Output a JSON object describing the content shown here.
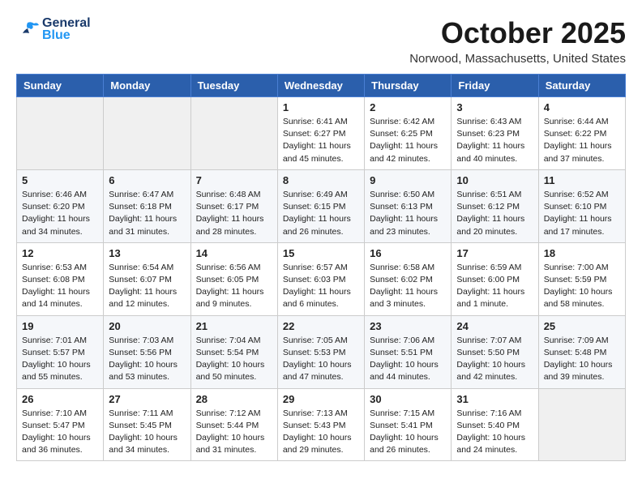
{
  "header": {
    "logo_line1": "General",
    "logo_line2": "Blue",
    "month": "October 2025",
    "location": "Norwood, Massachusetts, United States"
  },
  "weekdays": [
    "Sunday",
    "Monday",
    "Tuesday",
    "Wednesday",
    "Thursday",
    "Friday",
    "Saturday"
  ],
  "weeks": [
    [
      {
        "day": "",
        "info": ""
      },
      {
        "day": "",
        "info": ""
      },
      {
        "day": "",
        "info": ""
      },
      {
        "day": "1",
        "info": "Sunrise: 6:41 AM\nSunset: 6:27 PM\nDaylight: 11 hours\nand 45 minutes."
      },
      {
        "day": "2",
        "info": "Sunrise: 6:42 AM\nSunset: 6:25 PM\nDaylight: 11 hours\nand 42 minutes."
      },
      {
        "day": "3",
        "info": "Sunrise: 6:43 AM\nSunset: 6:23 PM\nDaylight: 11 hours\nand 40 minutes."
      },
      {
        "day": "4",
        "info": "Sunrise: 6:44 AM\nSunset: 6:22 PM\nDaylight: 11 hours\nand 37 minutes."
      }
    ],
    [
      {
        "day": "5",
        "info": "Sunrise: 6:46 AM\nSunset: 6:20 PM\nDaylight: 11 hours\nand 34 minutes."
      },
      {
        "day": "6",
        "info": "Sunrise: 6:47 AM\nSunset: 6:18 PM\nDaylight: 11 hours\nand 31 minutes."
      },
      {
        "day": "7",
        "info": "Sunrise: 6:48 AM\nSunset: 6:17 PM\nDaylight: 11 hours\nand 28 minutes."
      },
      {
        "day": "8",
        "info": "Sunrise: 6:49 AM\nSunset: 6:15 PM\nDaylight: 11 hours\nand 26 minutes."
      },
      {
        "day": "9",
        "info": "Sunrise: 6:50 AM\nSunset: 6:13 PM\nDaylight: 11 hours\nand 23 minutes."
      },
      {
        "day": "10",
        "info": "Sunrise: 6:51 AM\nSunset: 6:12 PM\nDaylight: 11 hours\nand 20 minutes."
      },
      {
        "day": "11",
        "info": "Sunrise: 6:52 AM\nSunset: 6:10 PM\nDaylight: 11 hours\nand 17 minutes."
      }
    ],
    [
      {
        "day": "12",
        "info": "Sunrise: 6:53 AM\nSunset: 6:08 PM\nDaylight: 11 hours\nand 14 minutes."
      },
      {
        "day": "13",
        "info": "Sunrise: 6:54 AM\nSunset: 6:07 PM\nDaylight: 11 hours\nand 12 minutes."
      },
      {
        "day": "14",
        "info": "Sunrise: 6:56 AM\nSunset: 6:05 PM\nDaylight: 11 hours\nand 9 minutes."
      },
      {
        "day": "15",
        "info": "Sunrise: 6:57 AM\nSunset: 6:03 PM\nDaylight: 11 hours\nand 6 minutes."
      },
      {
        "day": "16",
        "info": "Sunrise: 6:58 AM\nSunset: 6:02 PM\nDaylight: 11 hours\nand 3 minutes."
      },
      {
        "day": "17",
        "info": "Sunrise: 6:59 AM\nSunset: 6:00 PM\nDaylight: 11 hours\nand 1 minute."
      },
      {
        "day": "18",
        "info": "Sunrise: 7:00 AM\nSunset: 5:59 PM\nDaylight: 10 hours\nand 58 minutes."
      }
    ],
    [
      {
        "day": "19",
        "info": "Sunrise: 7:01 AM\nSunset: 5:57 PM\nDaylight: 10 hours\nand 55 minutes."
      },
      {
        "day": "20",
        "info": "Sunrise: 7:03 AM\nSunset: 5:56 PM\nDaylight: 10 hours\nand 53 minutes."
      },
      {
        "day": "21",
        "info": "Sunrise: 7:04 AM\nSunset: 5:54 PM\nDaylight: 10 hours\nand 50 minutes."
      },
      {
        "day": "22",
        "info": "Sunrise: 7:05 AM\nSunset: 5:53 PM\nDaylight: 10 hours\nand 47 minutes."
      },
      {
        "day": "23",
        "info": "Sunrise: 7:06 AM\nSunset: 5:51 PM\nDaylight: 10 hours\nand 44 minutes."
      },
      {
        "day": "24",
        "info": "Sunrise: 7:07 AM\nSunset: 5:50 PM\nDaylight: 10 hours\nand 42 minutes."
      },
      {
        "day": "25",
        "info": "Sunrise: 7:09 AM\nSunset: 5:48 PM\nDaylight: 10 hours\nand 39 minutes."
      }
    ],
    [
      {
        "day": "26",
        "info": "Sunrise: 7:10 AM\nSunset: 5:47 PM\nDaylight: 10 hours\nand 36 minutes."
      },
      {
        "day": "27",
        "info": "Sunrise: 7:11 AM\nSunset: 5:45 PM\nDaylight: 10 hours\nand 34 minutes."
      },
      {
        "day": "28",
        "info": "Sunrise: 7:12 AM\nSunset: 5:44 PM\nDaylight: 10 hours\nand 31 minutes."
      },
      {
        "day": "29",
        "info": "Sunrise: 7:13 AM\nSunset: 5:43 PM\nDaylight: 10 hours\nand 29 minutes."
      },
      {
        "day": "30",
        "info": "Sunrise: 7:15 AM\nSunset: 5:41 PM\nDaylight: 10 hours\nand 26 minutes."
      },
      {
        "day": "31",
        "info": "Sunrise: 7:16 AM\nSunset: 5:40 PM\nDaylight: 10 hours\nand 24 minutes."
      },
      {
        "day": "",
        "info": ""
      }
    ]
  ]
}
